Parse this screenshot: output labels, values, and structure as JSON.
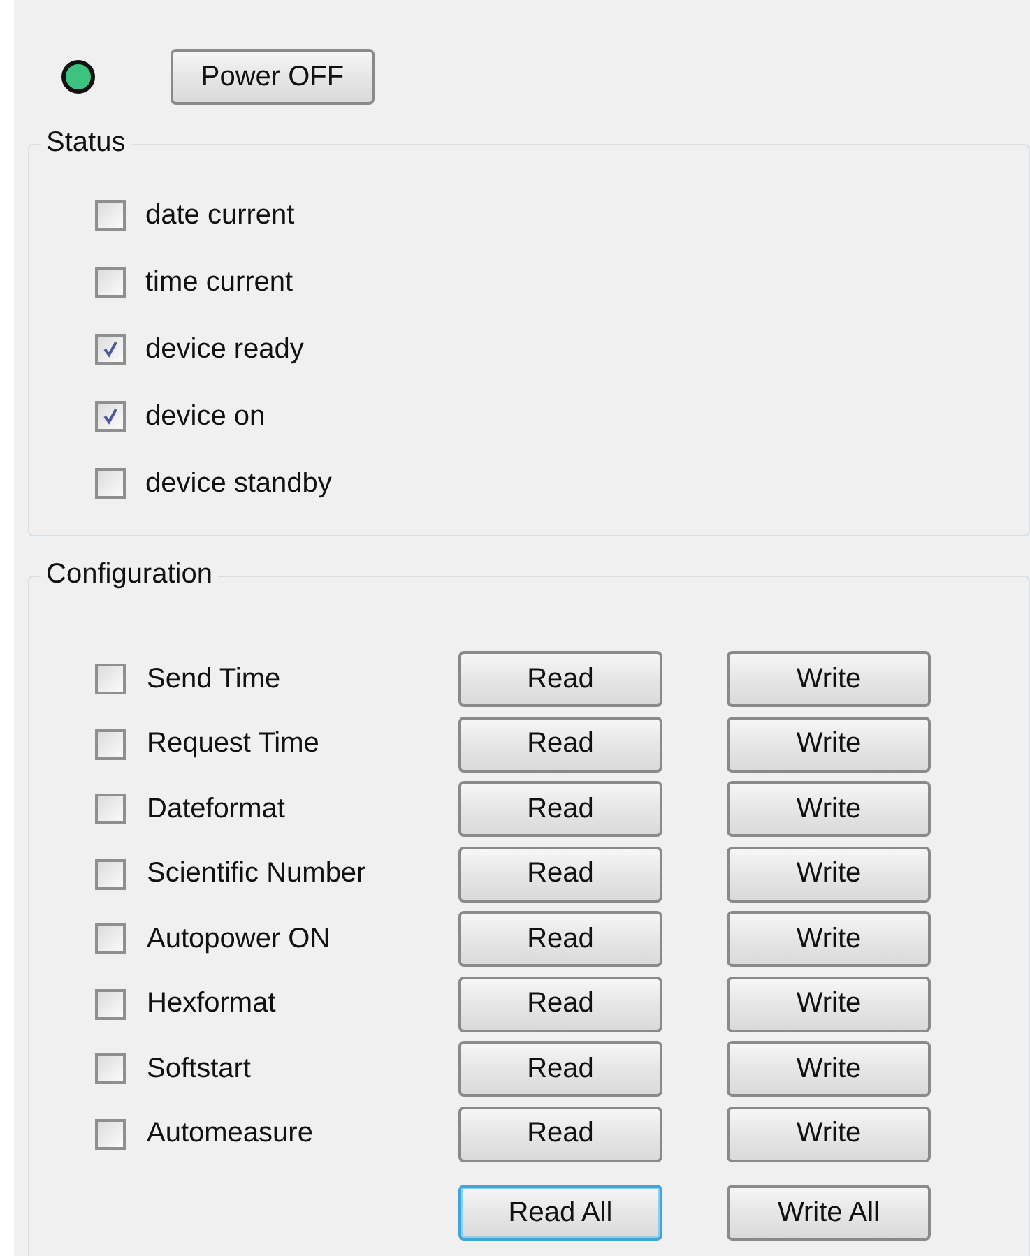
{
  "power": {
    "led_on": true,
    "button": "Power OFF"
  },
  "status": {
    "title": "Status",
    "items": [
      {
        "label": "date current",
        "checked": false
      },
      {
        "label": "time current",
        "checked": false
      },
      {
        "label": "device ready",
        "checked": true
      },
      {
        "label": "device on",
        "checked": true
      },
      {
        "label": "device standby",
        "checked": false
      }
    ]
  },
  "configuration": {
    "title": "Configuration",
    "rows": [
      {
        "label": "Send Time",
        "checked": false,
        "read": "Read",
        "write": "Write"
      },
      {
        "label": "Request Time",
        "checked": false,
        "read": "Read",
        "write": "Write"
      },
      {
        "label": "Dateformat",
        "checked": false,
        "read": "Read",
        "write": "Write"
      },
      {
        "label": "Scientific Number",
        "checked": false,
        "read": "Read",
        "write": "Write"
      },
      {
        "label": "Autopower ON",
        "checked": false,
        "read": "Read",
        "write": "Write"
      },
      {
        "label": "Hexformat",
        "checked": false,
        "read": "Read",
        "write": "Write"
      },
      {
        "label": "Softstart",
        "checked": false,
        "read": "Read",
        "write": "Write"
      },
      {
        "label": "Automeasure",
        "checked": false,
        "read": "Read",
        "write": "Write"
      }
    ],
    "read_all": {
      "label": "Read All",
      "focused": true
    },
    "write_all": {
      "label": "Write All",
      "focused": false
    }
  }
}
